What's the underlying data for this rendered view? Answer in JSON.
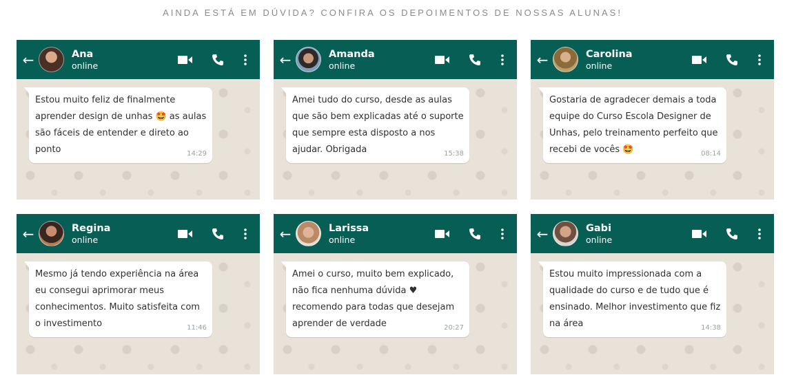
{
  "heading": "AINDA ESTÁ EM DÚVIDA? CONFIRA OS DEPOIMENTOS DE NOSSAS ALUNAS!",
  "colors": {
    "header": "#075e54",
    "chat_bg": "#e9e2d9",
    "bubble": "#ffffff"
  },
  "icons": [
    "back-arrow-icon",
    "video-call-icon",
    "phone-icon",
    "more-options-icon"
  ],
  "cards": [
    {
      "name": "Ana",
      "status": "online",
      "time": "14:29",
      "message": "Estou muito feliz de finalmente aprender design de unhas 🤩 as aulas são fáceis de entender e direto ao ponto"
    },
    {
      "name": "Amanda",
      "status": "online",
      "time": "15:38",
      "message": "Amei tudo do curso, desde as aulas que são bem explicadas até o suporte que sempre esta disposto a nos ajudar. Obrigada"
    },
    {
      "name": "Carolina",
      "status": "online",
      "time": "08:14",
      "message": "Gostaria de agradecer demais a toda equipe do Curso Escola Designer de Unhas, pelo treinamento perfeito que recebi de vocês 🤩"
    },
    {
      "name": "Regina",
      "status": "online",
      "time": "11:46",
      "message": "Mesmo já tendo experiência na área eu consegui aprimorar meus conhecimentos. Muito satisfeita com o investimento"
    },
    {
      "name": "Larissa",
      "status": "online",
      "time": "20:27",
      "message": "Amei o curso, muito bem explicado, não fica nenhuma dúvida ♥ recomendo para todas que desejam aprender de verdade"
    },
    {
      "name": "Gabi",
      "status": "online",
      "time": "14:38",
      "message": "Estou muito impressionada com a qualidade do curso e de tudo que é ensinado. Melhor investimento que fiz na área"
    }
  ]
}
